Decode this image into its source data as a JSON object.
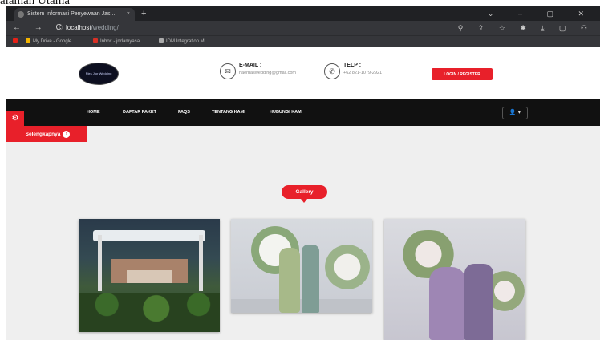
{
  "caption": "alaman Utama",
  "browser": {
    "tab_title": "Sistem Informasi Penyewaan Jas...",
    "tab_close": "×",
    "new_tab": "+",
    "window_controls": "⌄ – ▢ ✕",
    "nav_arrows": "← → C",
    "url_host": "localhost",
    "url_path": "/wedding/",
    "addr_icons": "⚲ ⇪ ☆ ✱ ⤓ ▢ ⚇",
    "bookmarks": [
      "My Drive - Google...",
      "Inbox - jndamyasa...",
      "IDM Integration M..."
    ]
  },
  "header": {
    "logo_text": "Ries Jtor Wedding",
    "email_label": "E-MAIL :",
    "email_value": "haerrlaswedding@gmail.com",
    "phone_label": "TELP :",
    "phone_value": "+62 821-1079-2921",
    "login_button": "LOGIN / REGISTER"
  },
  "navbar": {
    "items": [
      "HOME",
      "DAFTAR PAKET",
      "FAQS",
      "TENTANG KAMI",
      "HUBUNGI KAMI"
    ],
    "user_dropdown": "👤 ▾"
  },
  "banner": {
    "selengkapnya": "Selengkapnya",
    "gallery_label": "Gallery"
  },
  "colors": {
    "accent": "#e8202a",
    "navbar": "#111111",
    "banner_bg": "#efefef"
  }
}
